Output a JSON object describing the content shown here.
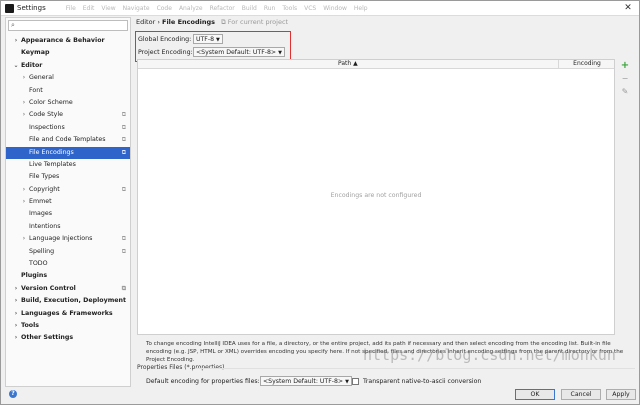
{
  "window": {
    "title": "Settings",
    "menu_blur": [
      "File",
      "Edit",
      "View",
      "Navigate",
      "Code",
      "Analyze",
      "Refactor",
      "Build",
      "Run",
      "Tools",
      "VCS",
      "Window",
      "Help"
    ],
    "controls": {
      "close": "✕"
    }
  },
  "sidebar": {
    "search_placeholder": "",
    "items": [
      {
        "label": "Appearance & Behavior",
        "chevron": "›",
        "bold": true
      },
      {
        "label": "Keymap",
        "bold": true
      },
      {
        "label": "Editor",
        "chevron": "⌄",
        "bold": true
      },
      {
        "label": "General",
        "chevron": "›"
      },
      {
        "label": "Font"
      },
      {
        "label": "Color Scheme",
        "chevron": "›"
      },
      {
        "label": "Code Style",
        "chevron": "›",
        "project": "⧉"
      },
      {
        "label": "Inspections",
        "project": "⧉"
      },
      {
        "label": "File and Code Templates",
        "project": "⧉"
      },
      {
        "label": "File Encodings",
        "project": "⧉",
        "selected": true
      },
      {
        "label": "Live Templates"
      },
      {
        "label": "File Types"
      },
      {
        "label": "Copyright",
        "chevron": "›",
        "project": "⧉"
      },
      {
        "label": "Emmet",
        "chevron": "›"
      },
      {
        "label": "Images"
      },
      {
        "label": "Intentions"
      },
      {
        "label": "Language Injections",
        "chevron": "›",
        "project": "⧉"
      },
      {
        "label": "Spelling",
        "project": "⧉"
      },
      {
        "label": "TODO"
      },
      {
        "label": "Plugins",
        "bold": true
      },
      {
        "label": "Version Control",
        "chevron": "›",
        "bold": true,
        "project": "⧉"
      },
      {
        "label": "Build, Execution, Deployment",
        "chevron": "›",
        "bold": true
      },
      {
        "label": "Languages & Frameworks",
        "chevron": "›",
        "bold": true
      },
      {
        "label": "Tools",
        "chevron": "›",
        "bold": true
      },
      {
        "label": "Other Settings",
        "chevron": "›",
        "bold": true
      }
    ]
  },
  "main": {
    "breadcrumb_parent": "Editor",
    "breadcrumb_sep": "›",
    "breadcrumb_current": "File Encodings",
    "breadcrumb_note": "⧉ For current project",
    "global_encoding_label": "Global Encoding:",
    "global_encoding_value": "UTF-8",
    "project_encoding_label": "Project Encoding:",
    "project_encoding_value": "<System Default: UTF-8>",
    "table_col_path": "Path ▲",
    "table_col_encoding": "Encoding",
    "table_empty": "Encodings are not configured",
    "description": "To change encoding IntelliJ IDEA uses for a file, a directory, or the entire project, add its path if necessary and then select encoding from the encoding list. Built-in file encoding (e.g. JSP, HTML or XML) overrides encoding you specify here. If not specified, files and directories inherit encoding settings from the parent directory or from the Project Encoding.",
    "properties_header": "Properties Files (*.properties)",
    "default_props_label": "Default encoding for properties files:",
    "default_props_value": "<System Default: UTF-8>",
    "native_ascii_label": "Transparent native-to-ascii conversion"
  },
  "buttons": {
    "ok": "OK",
    "cancel": "Cancel",
    "apply": "Apply",
    "help": "?"
  },
  "watermark": "https://blog.csdn.net/monkun",
  "colors": {
    "selection": "#2f65ca",
    "highlight": "#e03030",
    "add": "#3aa23a"
  }
}
